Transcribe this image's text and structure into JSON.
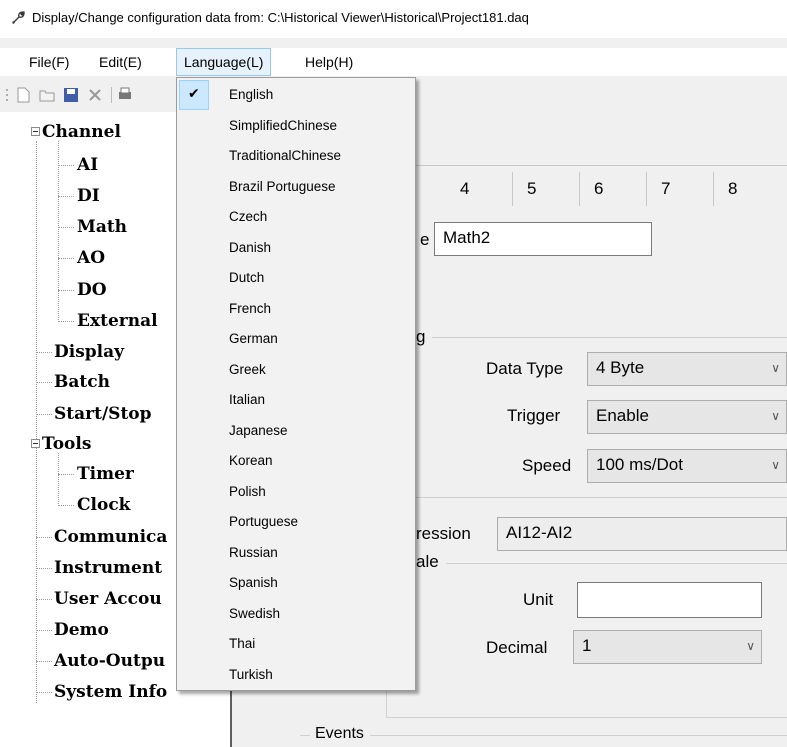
{
  "window": {
    "title": "Display/Change configuration data from: C:\\Historical Viewer\\Historical\\Project181.daq"
  },
  "menubar": {
    "items": [
      {
        "label": "File(F)"
      },
      {
        "label": "Edit(E)"
      },
      {
        "label": "Language(L)"
      },
      {
        "label": "Help(H)"
      }
    ]
  },
  "language_menu": {
    "checked_index": 0,
    "items": [
      {
        "label": "English"
      },
      {
        "label": "SimplifiedChinese"
      },
      {
        "label": "TraditionalChinese"
      },
      {
        "label": "Brazil Portuguese"
      },
      {
        "label": "Czech"
      },
      {
        "label": "Danish"
      },
      {
        "label": "Dutch"
      },
      {
        "label": "French"
      },
      {
        "label": "German"
      },
      {
        "label": "Greek"
      },
      {
        "label": "Italian"
      },
      {
        "label": "Japanese"
      },
      {
        "label": "Korean"
      },
      {
        "label": "Polish"
      },
      {
        "label": "Portuguese"
      },
      {
        "label": "Russian"
      },
      {
        "label": "Spanish"
      },
      {
        "label": "Swedish"
      },
      {
        "label": "Thai"
      },
      {
        "label": "Turkish"
      }
    ]
  },
  "tree": {
    "channel": "Channel",
    "ai": "AI",
    "di": "DI",
    "math": "Math",
    "ao": "AO",
    "do": "DO",
    "external": "External",
    "display": "Display",
    "batch": "Batch",
    "startstop": "Start/Stop",
    "tools": "Tools",
    "timer": "Timer",
    "clock": "Clock",
    "communication": "Communica",
    "instrument": "Instrument",
    "user_account": "User Accou",
    "demo": "Demo",
    "auto_output": "Auto-Outpu",
    "system_info": "System Info"
  },
  "tabs": {
    "numbers": [
      "4",
      "5",
      "6",
      "7",
      "8"
    ]
  },
  "form": {
    "name_label": "e",
    "name_value": "Math2",
    "group_label": "g",
    "data_type_label": "Data Type",
    "data_type_value": "4 Byte",
    "trigger_label": "Trigger",
    "trigger_value": "Enable",
    "speed_label": "Speed",
    "speed_value": "100 ms/Dot",
    "expression_label": "ression",
    "expression_value": "AI12-AI2",
    "scale_label": "ale",
    "unit_label": "Unit",
    "unit_value": "",
    "decimal_label": "Decimal",
    "decimal_value": "1",
    "events_label": "Events"
  },
  "colors": {
    "menu_highlight": "#cce8ff",
    "open_menu_bg": "#e5f1fb",
    "tree_divider": "#5f5f5f"
  }
}
